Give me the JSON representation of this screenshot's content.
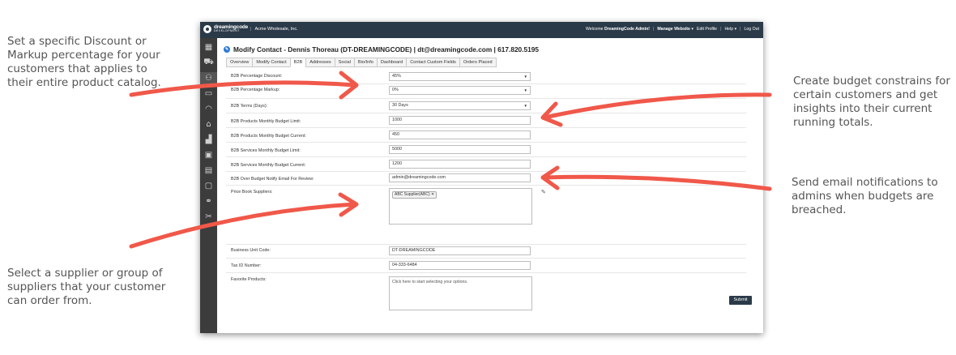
{
  "callouts": {
    "discount": "Set a specific Discount or Markup percentage for your customers that applies to their entire product catalog.",
    "budget": "Create budget constrains for certain customers and get insights into their current running totals.",
    "email": "Send email notifications to admins when budgets are breached.",
    "supplier": "Select a supplier or group of suppliers that your customer can order from."
  },
  "topbar": {
    "logo_line1": "dreamingcode",
    "logo_line2": "DEVELOPMENT",
    "company": "Acme Wholesale, Inc.",
    "welcome_prefix": "Welcome",
    "welcome_name": "DreamingCode Admin!",
    "manage_website": "Manage Website",
    "edit_profile": "Edit Profile",
    "help": "Help",
    "logout": "Log Out"
  },
  "sidebar_icons": [
    "dashboard-icon",
    "cart-icon",
    "users-icon",
    "monitor-icon",
    "rss-icon",
    "home-icon",
    "chart-icon",
    "image-icon",
    "inbox-icon",
    "contact-card-icon",
    "link-icon",
    "tools-icon"
  ],
  "page": {
    "title": "Modify Contact - Dennis Thoreau (DT-DREAMINGCODE) | dt@dreamingcode.com | 617.820.5195"
  },
  "tabs": [
    "Overview",
    "Modify Contact",
    "B2B",
    "Addresses",
    "Social",
    "Bio/Info",
    "Dashboard",
    "Contact Custom Fields",
    "Orders Placed"
  ],
  "form": {
    "percentage_discount": {
      "label": "B2B Percentage Discount:",
      "value": "45%"
    },
    "percentage_markup": {
      "label": "B2B Percentage Markup:",
      "value": "0%"
    },
    "terms": {
      "label": "B2B Terms (Days):",
      "value": "30 Days"
    },
    "products_budget_limit": {
      "label": "B2B Products Monthly Budget Limit:",
      "value": "1000"
    },
    "products_budget_current": {
      "label": "B2B Products Monthly Budget Current:",
      "value": "450"
    },
    "services_budget_limit": {
      "label": "B2B Services Monthly Budget Limit:",
      "value": "5000"
    },
    "services_budget_current": {
      "label": "B2B Services Monthly Budget Current:",
      "value": "1200"
    },
    "over_budget_email": {
      "label": "B2B Over Budget Notify Email For Review:",
      "value": "admin@dreamingcode.com"
    },
    "price_book_suppliers": {
      "label": "Price Book Suppliers:",
      "chip": "ABC Supplier(ABC)"
    },
    "business_unit_code": {
      "label": "Business Unit Code:",
      "value": "DT-DREAMINGCODE"
    },
    "tax_id": {
      "label": "Tax ID Number:",
      "value": "04-333-6484"
    },
    "favorite_products": {
      "label": "Favorite Products:",
      "placeholder": "Click here to start selecting your options."
    }
  },
  "submit_label": "Submit",
  "colors": {
    "arrow": "#f0584a",
    "topbar": "#2b3a49",
    "sidebar": "#3c3c3c"
  }
}
